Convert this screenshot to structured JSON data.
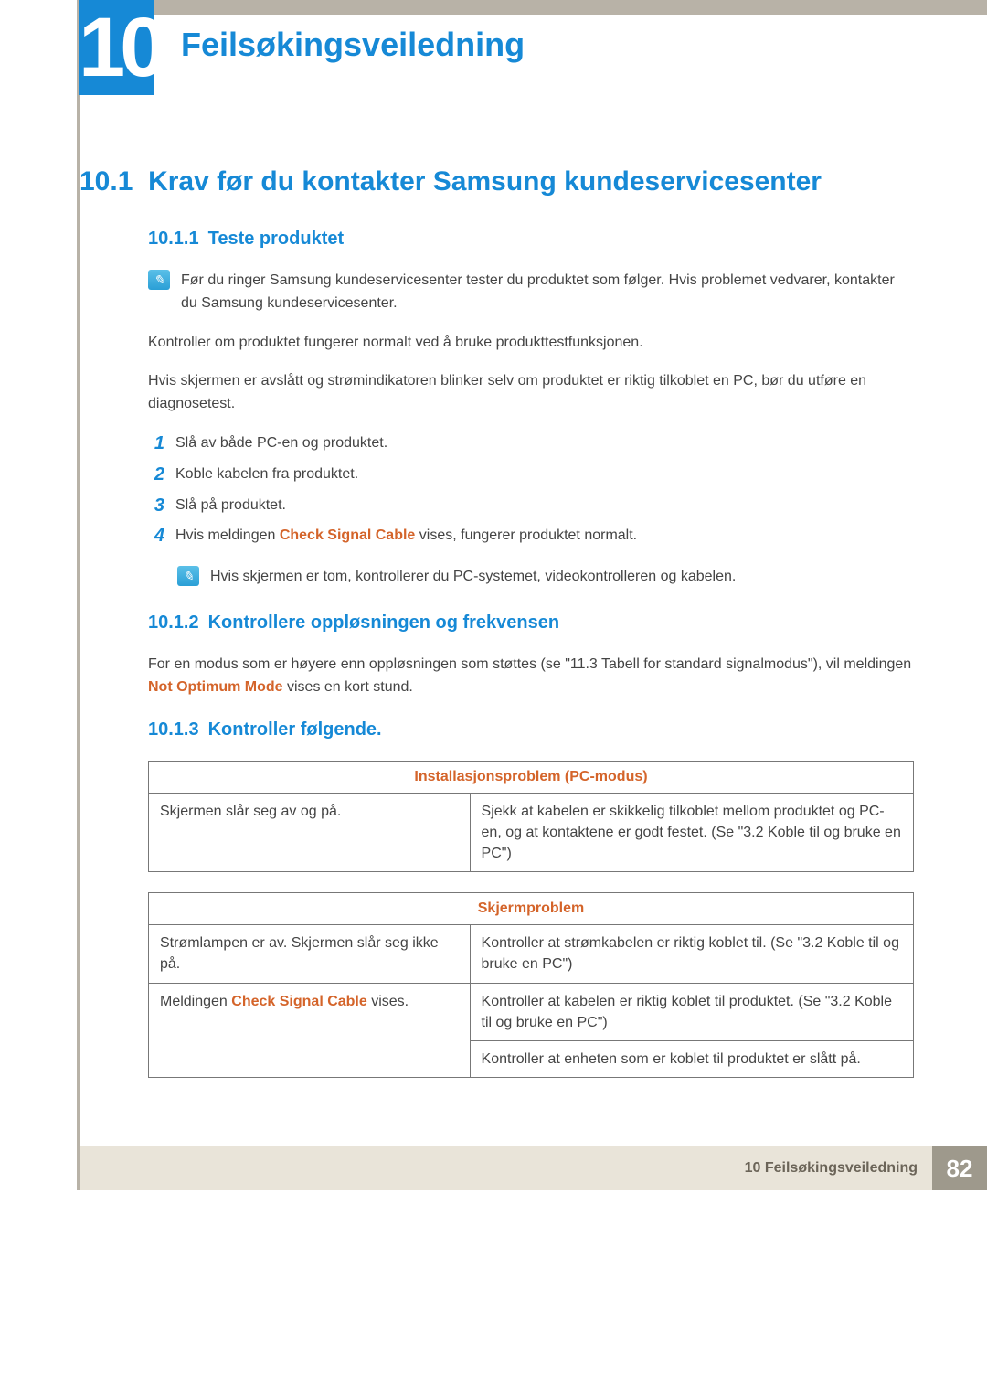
{
  "chapter": {
    "number": "10",
    "title": "Feilsøkingsveiledning"
  },
  "section": {
    "number": "10.1",
    "title": "Krav før du kontakter Samsung kundeservicesenter"
  },
  "s1": {
    "num": "10.1.1",
    "title": "Teste produktet",
    "note": "Før du ringer Samsung kundeservicesenter tester du produktet som følger. Hvis problemet vedvarer, kontakter du Samsung kundeservicesenter.",
    "p1": "Kontroller om produktet fungerer normalt ved å bruke produkttestfunksjonen.",
    "p2": "Hvis skjermen er avslått og strømindikatoren blinker selv om produktet er riktig tilkoblet en PC, bør du utføre en diagnosetest.",
    "steps": [
      "Slå av både PC-en og produktet.",
      "Koble kabelen fra produktet.",
      "Slå på produktet.",
      {
        "pre": "Hvis meldingen ",
        "kw": "Check Signal Cable",
        "post": " vises, fungerer produktet normalt."
      }
    ],
    "subnote": "Hvis skjermen er tom, kontrollerer du PC-systemet, videokontrolleren og kabelen."
  },
  "s2": {
    "num": "10.1.2",
    "title": "Kontrollere oppløsningen og frekvensen",
    "p_pre": "For en modus som er høyere enn oppløsningen som støttes (se \"11.3 Tabell for standard signalmodus\"), vil meldingen ",
    "kw": "Not Optimum Mode",
    "p_post": " vises en kort stund."
  },
  "s3": {
    "num": "10.1.3",
    "title": "Kontroller følgende.",
    "table1": {
      "header": "Installasjonsproblem (PC-modus)",
      "rows": [
        {
          "left": "Skjermen slår seg av og på.",
          "right": "Sjekk at kabelen er skikkelig tilkoblet mellom produktet og PC-en, og at kontaktene er godt festet. (Se \"3.2 Koble til og bruke en PC\")"
        }
      ]
    },
    "table2": {
      "header": "Skjermproblem",
      "rows": [
        {
          "left": "Strømlampen er av. Skjermen slår seg ikke på.",
          "right": "Kontroller at strømkabelen er riktig koblet til. (Se \"3.2 Koble til og bruke en PC\")"
        },
        {
          "left_pre": "Meldingen ",
          "left_kw": "Check Signal Cable",
          "left_post": " vises.",
          "right": "Kontroller at kabelen er riktig koblet til produktet. (Se \"3.2 Koble til og bruke en PC\")"
        },
        {
          "left": "",
          "right": "Kontroller at enheten som er koblet til produktet er slått på."
        }
      ]
    }
  },
  "footer": {
    "text": "10 Feilsøkingsveiledning",
    "page": "82"
  }
}
